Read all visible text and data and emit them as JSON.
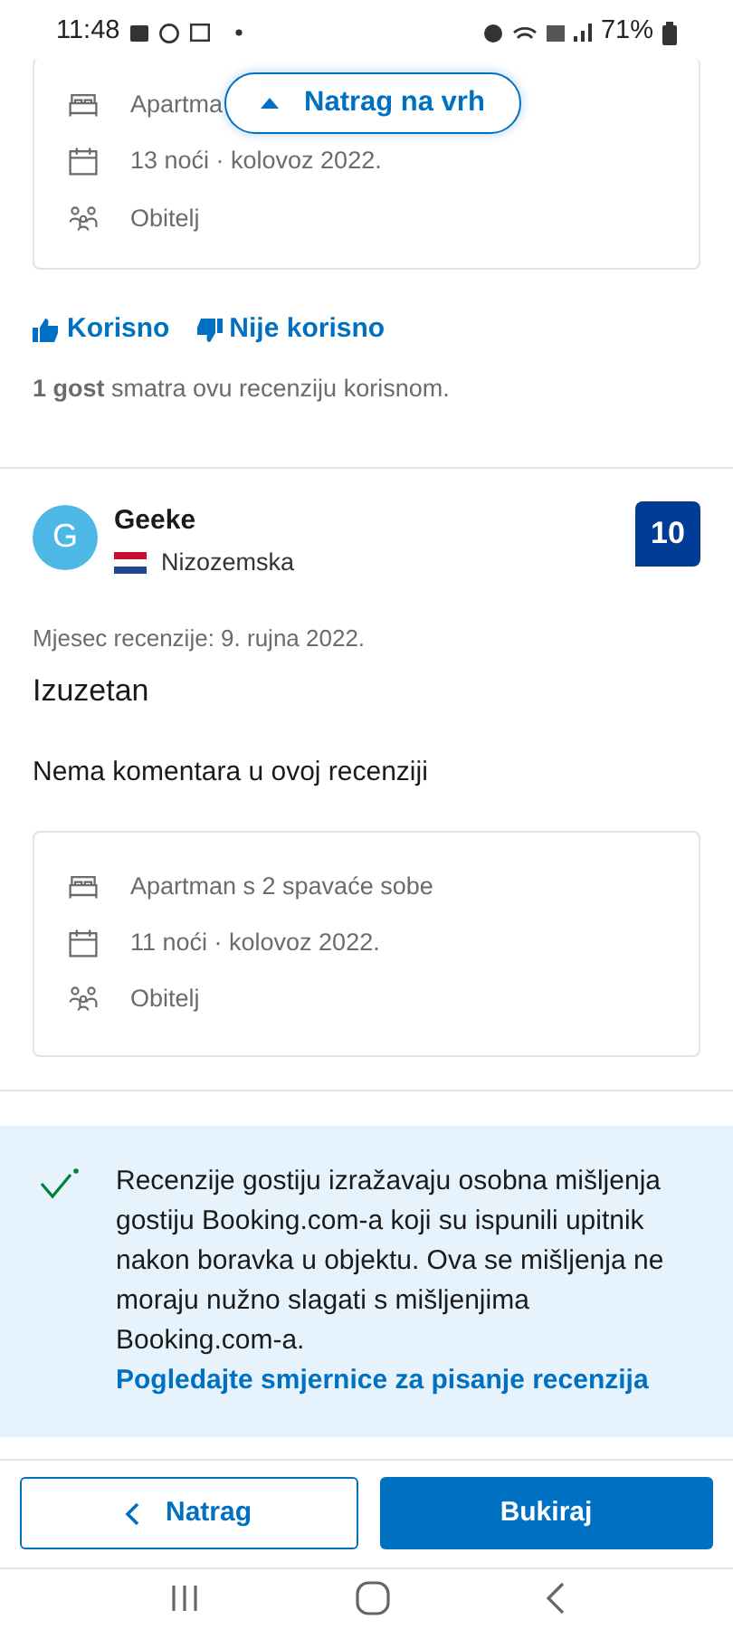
{
  "status_bar": {
    "time": "11:48",
    "battery": "71%"
  },
  "back_to_top": {
    "label": "Natrag na vrh"
  },
  "previous_review": {
    "stay": [
      {
        "kind": "room",
        "text": "Apartma"
      },
      {
        "kind": "dates",
        "text": "13 noći · kolovoz 2022."
      },
      {
        "kind": "group",
        "text": "Obitelj"
      }
    ],
    "helpful": "Korisno",
    "not_helpful": "Nije korisno",
    "helpful_count": "**1 gost** smatra ovu recenziju korisnom."
  },
  "review": {
    "initial": "G",
    "name": "Geeke",
    "country": "Nizozemska",
    "score": "10",
    "date": "Mjesec recenzije: 9. rujna 2022.",
    "title": "Izuzetan",
    "comment": "Nema komentara u ovoj recenziji",
    "stay": [
      {
        "kind": "room",
        "text": "Apartman s 2 spavaće sobe"
      },
      {
        "kind": "dates",
        "text": "11 noći · kolovoz 2022."
      },
      {
        "kind": "group",
        "text": "Obitelj"
      }
    ]
  },
  "notice": {
    "text": "Recenzije gostiju izražavaju osobna mišljenja gostiju Booking.com-a koji su ispunili upitnik nakon boravka u objektu. Ova se mišljenja ne moraju nužno slagati s mišljenjima Booking.com-a.",
    "link": "Pogledajte smjernice za pisanje recenzija"
  },
  "footer": {
    "back": "Natrag",
    "book": "Bukiraj"
  }
}
